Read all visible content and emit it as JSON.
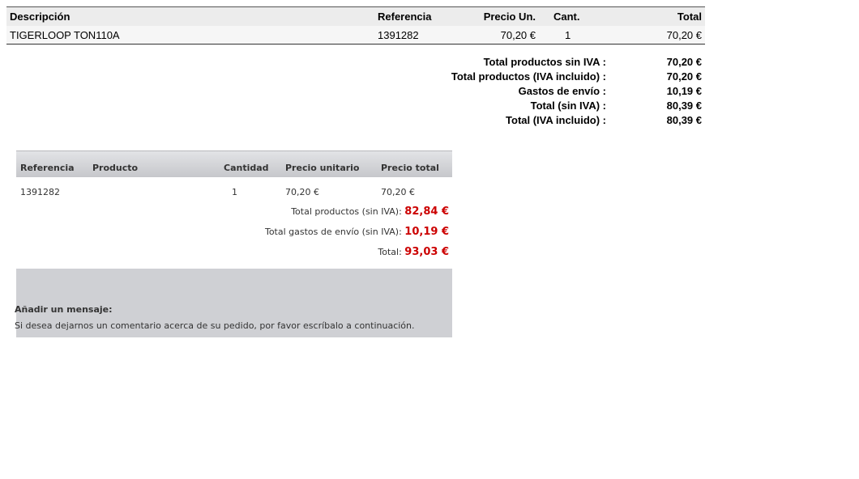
{
  "invoice": {
    "headers": {
      "description": "Descripción",
      "reference": "Referencia",
      "unit_price": "Precio Un.",
      "qty": "Cant.",
      "total": "Total"
    },
    "row": {
      "description": "TIGERLOOP TON110A",
      "reference": "1391282",
      "unit_price": "70,20 €",
      "qty": "1",
      "total": "70,20 €"
    }
  },
  "summary": {
    "labels": [
      "Total productos sin IVA :",
      "Total productos (IVA incluido) :",
      "Gastos de envío :",
      "Total (sin IVA) :",
      "Total (IVA incluido) :"
    ],
    "values": [
      "70,20 €",
      "70,20 €",
      "10,19 €",
      "80,39 €",
      "80,39 €"
    ]
  },
  "order": {
    "headers": {
      "reference": "Referencia",
      "product": "Producto",
      "quantity": "Cantidad",
      "unit_price": "Precio unitario",
      "total_price": "Precio total"
    },
    "row": {
      "reference": "1391282",
      "product": "",
      "quantity": "1",
      "unit_price": "70,20 €",
      "total_price": "70,20 €"
    },
    "totals": [
      {
        "label": "Total productos (sin IVA):",
        "amount": "82,84 €"
      },
      {
        "label": "Total gastos de envío (sin IVA):",
        "amount": "10,19 €"
      },
      {
        "label": "Total:",
        "amount": "93,03 €"
      }
    ]
  },
  "message": {
    "title": "Añadir un mensaje:",
    "text": "Si desea dejarnos un comentario acerca de su pedido, por favor escríbalo a continuación."
  },
  "colors": {
    "accent_red": "#cc0000",
    "panel_gray": "#cfd0d4"
  }
}
